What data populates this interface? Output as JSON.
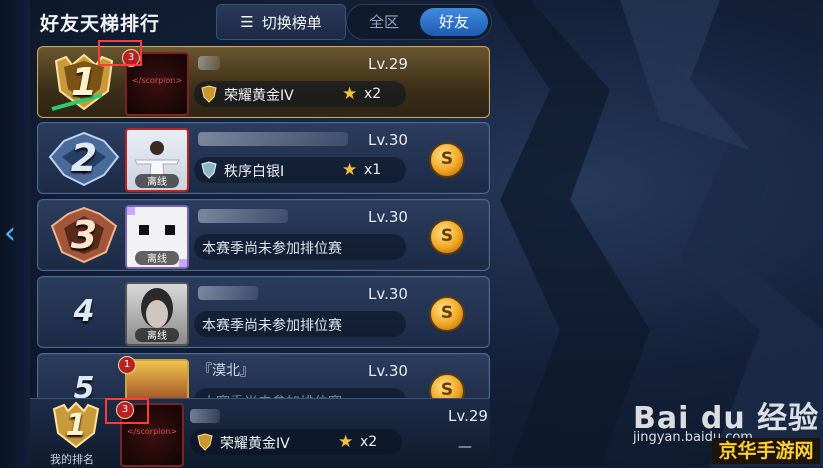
{
  "header": {
    "title": "好友天梯排行",
    "switch_label": "切换榜单",
    "scope_tabs": [
      "全区",
      "好友"
    ],
    "active_scope": "好友"
  },
  "rows": [
    {
      "rank": "1",
      "name": "",
      "level": "Lv.29",
      "tier": "荣耀黄金IV",
      "stars": "x2",
      "status": "",
      "badge": "3",
      "avatar_text": "</scorpion>",
      "has_coin": false
    },
    {
      "rank": "2",
      "name": "",
      "level": "Lv.30",
      "tier": "秩序白银I",
      "stars": "x1",
      "status": "离线",
      "badge": "",
      "avatar_text": "",
      "has_coin": true
    },
    {
      "rank": "3",
      "name": "",
      "level": "Lv.30",
      "tier": "",
      "note": "本赛季尚未参加排位赛",
      "status": "离线",
      "badge": "",
      "has_coin": true
    },
    {
      "rank": "4",
      "name": "",
      "level": "Lv.30",
      "tier": "",
      "note": "本赛季尚未参加排位赛",
      "status": "离线",
      "badge": "",
      "has_coin": true
    },
    {
      "rank": "5",
      "name": "『漠北』",
      "level": "Lv.30",
      "tier": "",
      "note": "本赛季尚未参加排位赛",
      "status": "",
      "badge": "1",
      "has_coin": true
    }
  ],
  "my_rank": {
    "rank": "1",
    "label": "我的排名",
    "level": "Lv.29",
    "tier": "荣耀黄金IV",
    "stars": "x2",
    "badge": "3",
    "avatar_text": "</scorpion>",
    "dash": "—"
  },
  "icons": {
    "list": "list-icon",
    "star": "star-icon",
    "coin": "gold-coin-icon",
    "tier": "tier-emblem-icon",
    "back": "chevron-left-icon"
  },
  "colors": {
    "accent": "#2f7fd8",
    "gold": "#f3c13a",
    "row_bg": "#24365a",
    "highlight": "#ff3b3b"
  },
  "watermark": {
    "logo": "Bai du 经验",
    "url": "jingyan.baidu.com",
    "site": "京华手游网"
  }
}
